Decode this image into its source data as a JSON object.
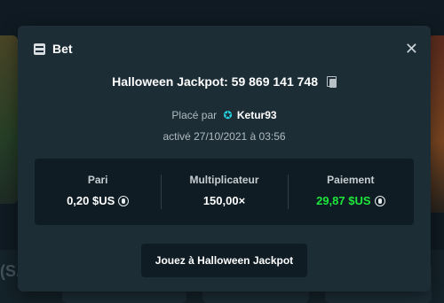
{
  "modal": {
    "title": "Bet",
    "close_glyph": "✕",
    "jackpot_line": "Halloween Jackpot: 59 869 141 748",
    "placed_prefix": "Placé par",
    "username": "Ketur93",
    "date_line": "activé 27/10/2021 à 03:56",
    "stats": [
      {
        "label": "Pari",
        "value": "0,20 $US"
      },
      {
        "label": "Multiplicateur",
        "value": "150,00×"
      },
      {
        "label": "Paiement",
        "value": "29,87 $US"
      }
    ],
    "play_button": "Jouez à Halloween Jackpot"
  },
  "background": {
    "fragment_text": "(S."
  },
  "icons": {
    "bet": "bet-slip-icon",
    "close": "close-icon",
    "copy": "copy-icon",
    "user_badge": "star-icon",
    "currency": "coin-icon"
  },
  "colors": {
    "payout_green": "#1ee63b",
    "badge_cyan": "#25d6e4",
    "modal_bg": "#1c2d36"
  }
}
